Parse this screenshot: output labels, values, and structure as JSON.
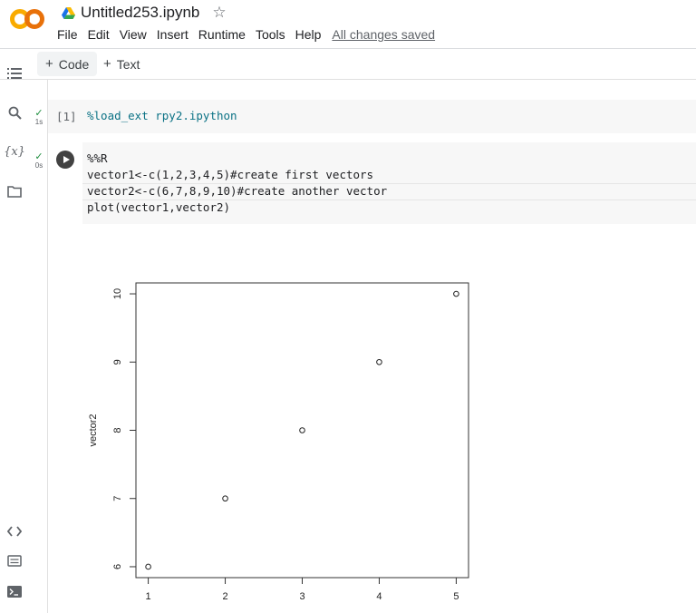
{
  "header": {
    "doc_title": "Untitled253.ipynb",
    "menu": [
      "File",
      "Edit",
      "View",
      "Insert",
      "Runtime",
      "Tools",
      "Help"
    ],
    "saved_status": "All changes saved",
    "brand_color": "#f9ab00"
  },
  "toolbar": {
    "code_label": "Code",
    "text_label": "Text"
  },
  "sidebar": {
    "icons": [
      "table-of-contents-icon",
      "search-icon",
      "variables-icon",
      "files-icon",
      "code-snippets-icon",
      "command-palette-icon",
      "terminal-icon"
    ]
  },
  "cells": [
    {
      "prompt": "[1]",
      "status_time": "1s",
      "code": "%load_ext rpy2.ipython"
    },
    {
      "status_time": "0s",
      "lines": [
        "%%R",
        "vector1<-c(1,2,3,4,5)#create first vectors",
        "vector2<-c(6,7,8,9,10)#create another vector",
        "plot(vector1,vector2)"
      ]
    }
  ],
  "chart_data": {
    "type": "scatter",
    "x": [
      1,
      2,
      3,
      4,
      5
    ],
    "y": [
      6,
      7,
      8,
      9,
      10
    ],
    "xlabel": "",
    "ylabel": "vector2",
    "xlim": [
      0.84,
      5.16
    ],
    "ylim": [
      5.84,
      10.16
    ],
    "xticks": [
      1,
      2,
      3,
      4,
      5
    ],
    "yticks": [
      6,
      7,
      8,
      9,
      10
    ],
    "marker": "open-circle",
    "grid": false
  }
}
